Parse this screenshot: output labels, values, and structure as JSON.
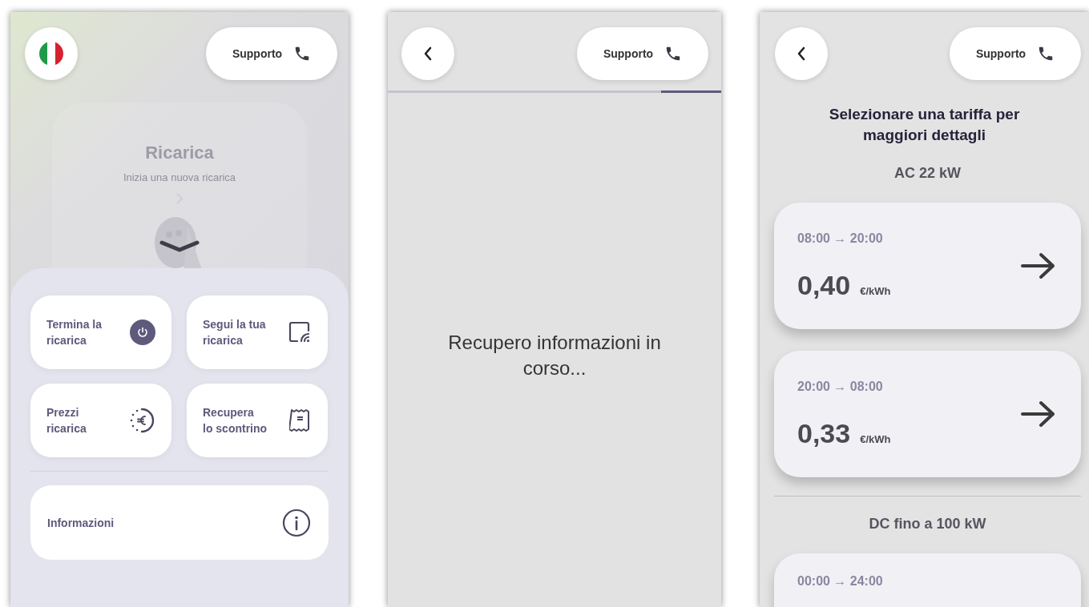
{
  "screens": [
    {
      "kind": "home",
      "support_button": "Supporto",
      "background_card": {
        "title": "Ricarica",
        "subtitle": "Inizia una nuova ricarica"
      },
      "tiles": [
        {
          "label": "Termina la\nricarica"
        },
        {
          "label": "Segui la tua\nricarica"
        },
        {
          "label": "Prezzi\nricarica"
        },
        {
          "label": "Recupera\nlo scontrino"
        }
      ],
      "info_button": "Informazioni"
    },
    {
      "kind": "loading",
      "support_button": "Supporto",
      "progress": {
        "level": 0.18
      },
      "message": "Recupero informazioni in corso..."
    },
    {
      "kind": "tariffs",
      "support_button": "Supporto",
      "title": "Selezionare una tariffa per maggiori dettagli",
      "groups": [
        {
          "heading": "AC 22 kW",
          "tariffs": [
            {
              "time": "08:00 → 20:00",
              "price": "0,40",
              "unit": "€/kWh"
            },
            {
              "time": "20:00 → 08:00",
              "price": "0,33",
              "unit": "€/kWh"
            }
          ]
        },
        {
          "heading": "DC fino a 100 kW",
          "tariffs": [
            {
              "time": "00:00 → 24:00"
            }
          ]
        }
      ]
    }
  ]
}
